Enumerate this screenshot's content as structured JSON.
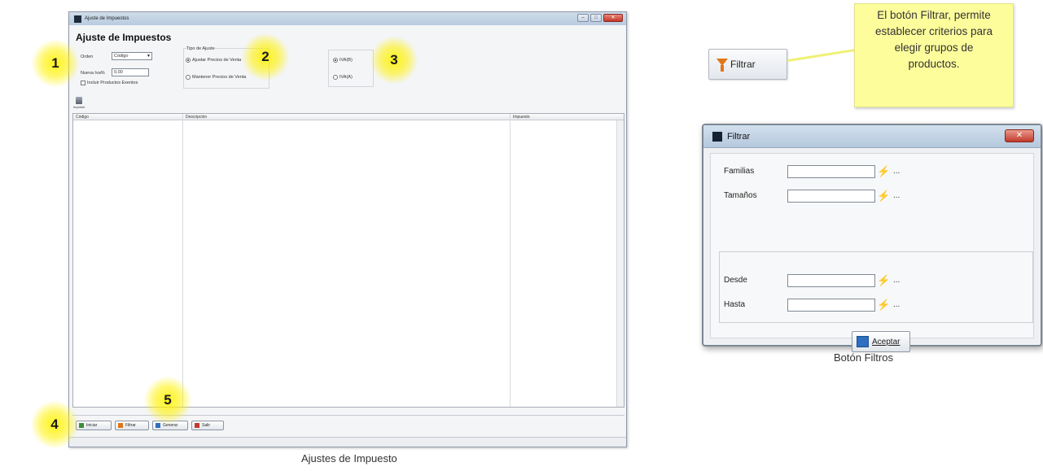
{
  "main_window": {
    "title": "Ajuste de Impuestos",
    "form_title": "Ajuste de Impuestos",
    "fields": {
      "orden_label": "Orden",
      "orden_value": "Código",
      "nueva_iva_label": "Nueva Iva%",
      "nueva_iva_value": "0,00",
      "checkbox_label": "Incluir Productos Exentos"
    },
    "tipo_ajuste": {
      "group_label": "Tipo de Ajuste",
      "option1": "Ajustar Precios de Venta",
      "option2": "Mantener Precios de Venta"
    },
    "iva_options": {
      "option1": "IVA(B)",
      "option2": "IVA(A)"
    },
    "small_button_label": "Imprimir",
    "grid_columns": [
      "Código",
      "Descripción",
      "Impuesto"
    ],
    "buttons": [
      "Iniciar",
      "Filtrar",
      "Generar",
      "Salir"
    ]
  },
  "markers": [
    "1",
    "2",
    "3",
    "4",
    "5"
  ],
  "caption_left": "Ajustes de Impuesto",
  "filtrar_button": "Filtrar",
  "note": {
    "lines": [
      "El botón Filtrar, permite",
      "establecer criterios para",
      "elegir grupos de",
      "productos."
    ]
  },
  "filter_dialog": {
    "title": "Filtrar",
    "close_label": "✕",
    "rows": [
      "Familias",
      "Tamaños",
      "Desde",
      "Hasta"
    ],
    "dots": "...",
    "accept_label": "Aceptar"
  },
  "caption_right": "Botón Filtros",
  "colors": {
    "marker": "#fff200",
    "note_bg": "#fdfd9c",
    "filter_icon": "#e0761a"
  }
}
